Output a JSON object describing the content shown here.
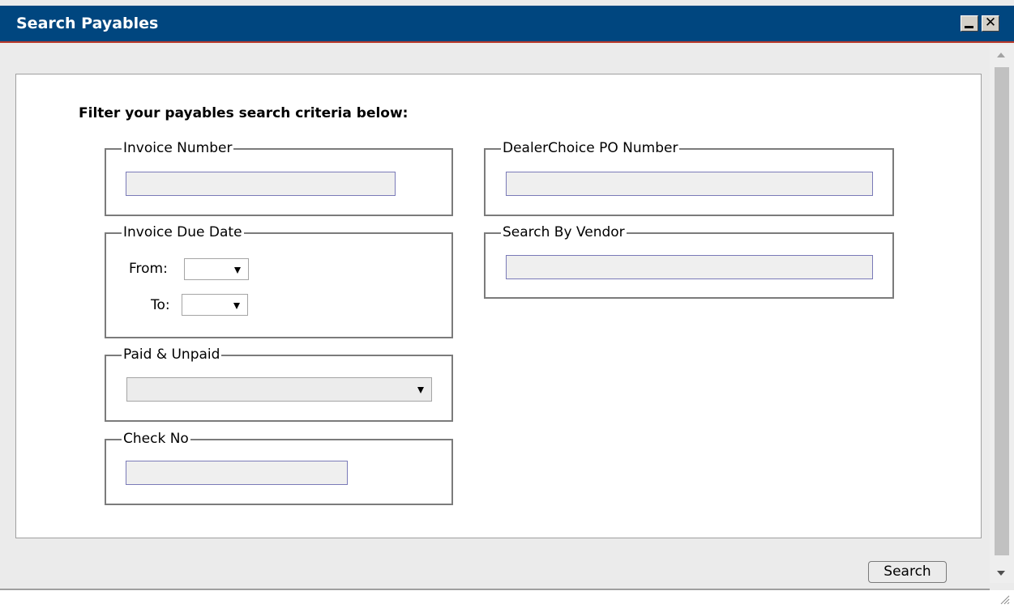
{
  "window": {
    "title": "Search Payables",
    "minimize_icon": "minimize-icon",
    "close_icon": "close-icon",
    "close_glyph": "✕"
  },
  "form": {
    "heading": "Filter your payables search criteria below:",
    "invoice_number": {
      "legend": "Invoice Number",
      "value": ""
    },
    "dealerchoice_po": {
      "legend": "DealerChoice PO Number",
      "value": ""
    },
    "invoice_due_date": {
      "legend": "Invoice Due Date",
      "from_label": "From:",
      "to_label": "To:",
      "from_value": "",
      "to_value": ""
    },
    "search_by_vendor": {
      "legend": "Search By Vendor",
      "value": ""
    },
    "paid_unpaid": {
      "legend": "Paid & Unpaid",
      "value": ""
    },
    "check_no": {
      "legend": "Check No",
      "value": ""
    }
  },
  "actions": {
    "search_label": "Search"
  },
  "colors": {
    "titlebar": "#00467f",
    "titlebar_accent": "#b9392a",
    "input_border": "#7a7ab8"
  }
}
